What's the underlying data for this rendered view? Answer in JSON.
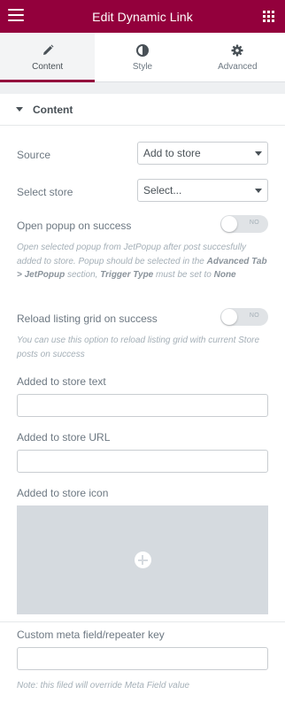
{
  "header": {
    "title": "Edit Dynamic Link",
    "menu_icon": "hamburger-icon",
    "apps_icon": "grid-icon",
    "color": "#93003c"
  },
  "tabs": [
    {
      "label": "Content",
      "icon": "pencil-icon",
      "active": true
    },
    {
      "label": "Style",
      "icon": "half-circle-icon",
      "active": false
    },
    {
      "label": "Advanced",
      "icon": "gear-icon",
      "active": false
    }
  ],
  "section": {
    "title": "Content"
  },
  "fields": {
    "source": {
      "label": "Source",
      "value": "Add to store"
    },
    "select_store": {
      "label": "Select store",
      "value": "Select..."
    },
    "open_popup": {
      "label": "Open popup on success",
      "toggle_text": "NO",
      "desc_1": "Open selected popup from JetPopup after post succesfully added to store. Popup should be selected in the ",
      "desc_b1": "Advanced Tab > JetPopup",
      "desc_2": " section, ",
      "desc_b2": "Trigger Type",
      "desc_3": " must be set to ",
      "desc_b3": "None"
    },
    "reload_grid": {
      "label": "Reload listing grid on success",
      "toggle_text": "NO",
      "desc": "You can use this option to reload listing grid with current Store posts on success"
    },
    "added_text": {
      "label": "Added to store text",
      "value": ""
    },
    "added_url": {
      "label": "Added to store URL",
      "value": ""
    },
    "added_icon": {
      "label": "Added to store icon"
    },
    "meta_key": {
      "label": "Custom meta field/repeater key",
      "value": "",
      "note": "Note: this filed will override Meta Field value"
    }
  }
}
